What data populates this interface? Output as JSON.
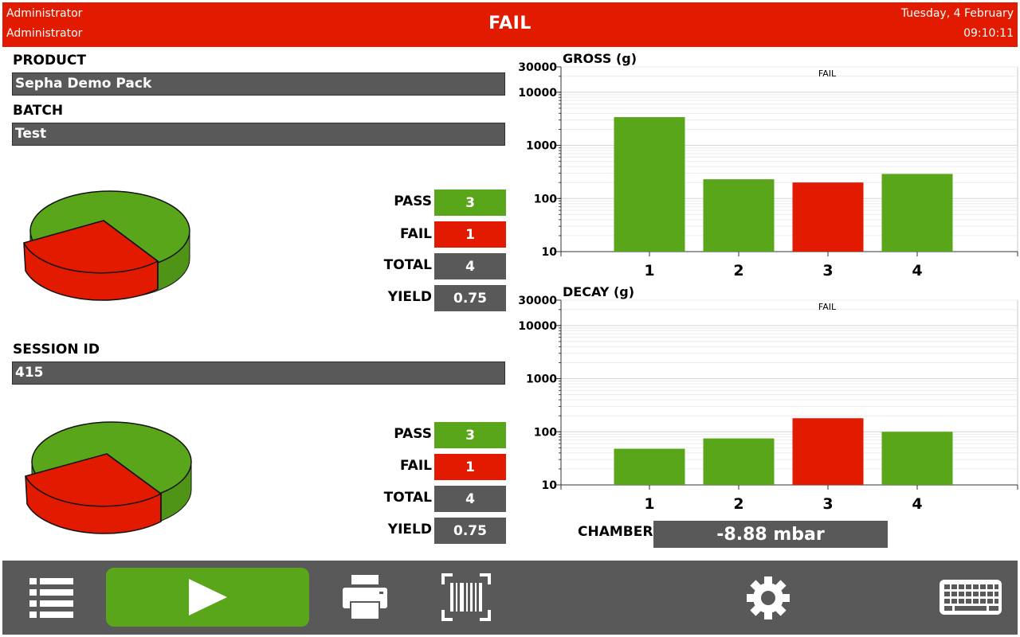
{
  "header": {
    "user_line1": "Administrator",
    "user_line2": "Administrator",
    "status": "FAIL",
    "date": "Tuesday, 4 February",
    "time": "09:10:11"
  },
  "fields": {
    "product_label": "PRODUCT",
    "product_value": "Sepha Demo Pack",
    "batch_label": "BATCH",
    "batch_value": "Test",
    "session_label": "SESSION ID",
    "session_value": "415"
  },
  "stats": [
    {
      "pass_label": "PASS",
      "pass": "3",
      "fail_label": "FAIL",
      "fail": "1",
      "total_label": "TOTAL",
      "total": "4",
      "yield_label": "YIELD",
      "yield": "0.75"
    },
    {
      "pass_label": "PASS",
      "pass": "3",
      "fail_label": "FAIL",
      "fail": "1",
      "total_label": "TOTAL",
      "total": "4",
      "yield_label": "YIELD",
      "yield": "0.75"
    }
  ],
  "colors": {
    "pass": "#5aa61a",
    "fail": "#e21a00",
    "panel": "#595959"
  },
  "chart_data": [
    {
      "type": "bar",
      "title": "GROSS (g)",
      "annotation": "FAIL",
      "scale": "log",
      "categories": [
        "1",
        "2",
        "3",
        "4"
      ],
      "values": [
        3400,
        230,
        200,
        290
      ],
      "status": [
        "pass",
        "pass",
        "fail",
        "pass"
      ],
      "ylim": [
        10,
        30000
      ],
      "yticks": [
        "10",
        "100",
        "1000",
        "10000",
        "30000"
      ],
      "grid": true
    },
    {
      "type": "bar",
      "title": "DECAY (g)",
      "annotation": "FAIL",
      "scale": "log",
      "categories": [
        "1",
        "2",
        "3",
        "4"
      ],
      "values": [
        48,
        75,
        180,
        100
      ],
      "status": [
        "pass",
        "pass",
        "fail",
        "pass"
      ],
      "ylim": [
        10,
        30000
      ],
      "yticks": [
        "10",
        "100",
        "1000",
        "10000",
        "30000"
      ],
      "grid": true
    }
  ],
  "chamber": {
    "label": "CHAMBER",
    "value": "-8.88 mbar"
  },
  "toolbar": {
    "icons": [
      "list-icon",
      "play-icon",
      "printer-icon",
      "barcode-scan-icon",
      "gear-icon",
      "keyboard-icon"
    ]
  }
}
